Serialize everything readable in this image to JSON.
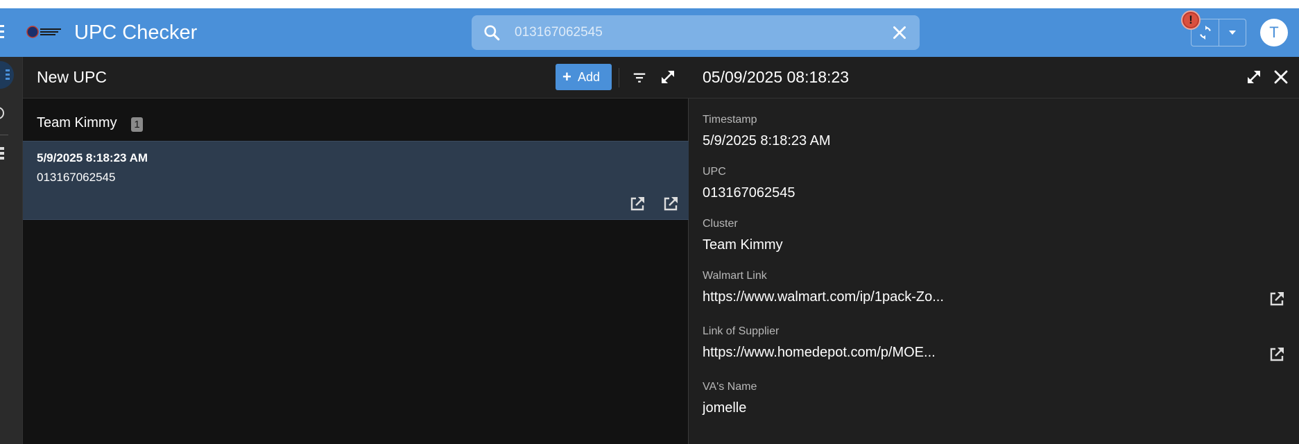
{
  "header": {
    "title": "UPC Checker",
    "search_value": "013167062545",
    "alert_symbol": "!",
    "avatar_letter": "T",
    "brand_color": "#4a90d9"
  },
  "list": {
    "title": "New UPC",
    "add_label": "Add",
    "group": {
      "name": "Team Kimmy",
      "count": "1"
    },
    "items": [
      {
        "time": "5/9/2025 8:18:23 AM",
        "upc": "013167062545"
      }
    ]
  },
  "detail": {
    "title": "05/09/2025 08:18:23",
    "fields": [
      {
        "label": "Timestamp",
        "value": "5/9/2025 8:18:23 AM"
      },
      {
        "label": "UPC",
        "value": "013167062545"
      },
      {
        "label": "Cluster",
        "value": "Team Kimmy"
      },
      {
        "label": "Walmart Link",
        "value": "https://www.walmart.com/ip/1pack-Zo..."
      },
      {
        "label": "Link of Supplier",
        "value": "https://www.homedepot.com/p/MOE..."
      },
      {
        "label": "VA's Name",
        "value": "jomelle"
      }
    ]
  },
  "icons": {
    "search": "search-icon",
    "clear": "close-icon",
    "sync": "sync-icon",
    "dropdown": "caret-down-icon",
    "filter": "filter-icon",
    "expand": "expand-icon",
    "external": "external-link-icon"
  }
}
